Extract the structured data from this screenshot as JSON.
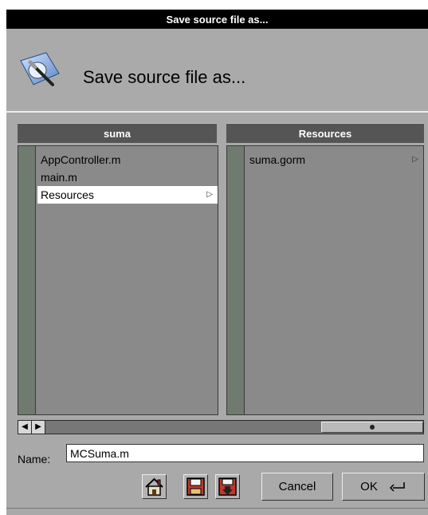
{
  "window": {
    "title": "Save source file as...",
    "header_title": "Save source file as..."
  },
  "browser": {
    "columns": [
      {
        "title": "suma",
        "items": [
          {
            "label": "AppController.m",
            "selected": false,
            "has_children": false
          },
          {
            "label": "main.m",
            "selected": false,
            "has_children": false
          },
          {
            "label": "Resources",
            "selected": true,
            "has_children": true
          }
        ]
      },
      {
        "title": "Resources",
        "items": [
          {
            "label": "suma.gorm",
            "selected": false,
            "has_children": true
          }
        ]
      }
    ]
  },
  "name_field": {
    "label": "Name:",
    "value": "MCSuma.m"
  },
  "buttons": {
    "home_icon": "home-icon",
    "disk_icon": "floppy-disk-icon",
    "mount_icon": "floppy-disk-down-arrow-icon",
    "cancel": "Cancel",
    "ok": "OK",
    "ok_icon": "return-key-icon"
  },
  "colors": {
    "title_bg": "#000000",
    "window_bg": "#a9a9a9",
    "column_header_bg": "#555555",
    "list_bg": "#8a8a8a",
    "selected_bg": "#ffffff"
  }
}
